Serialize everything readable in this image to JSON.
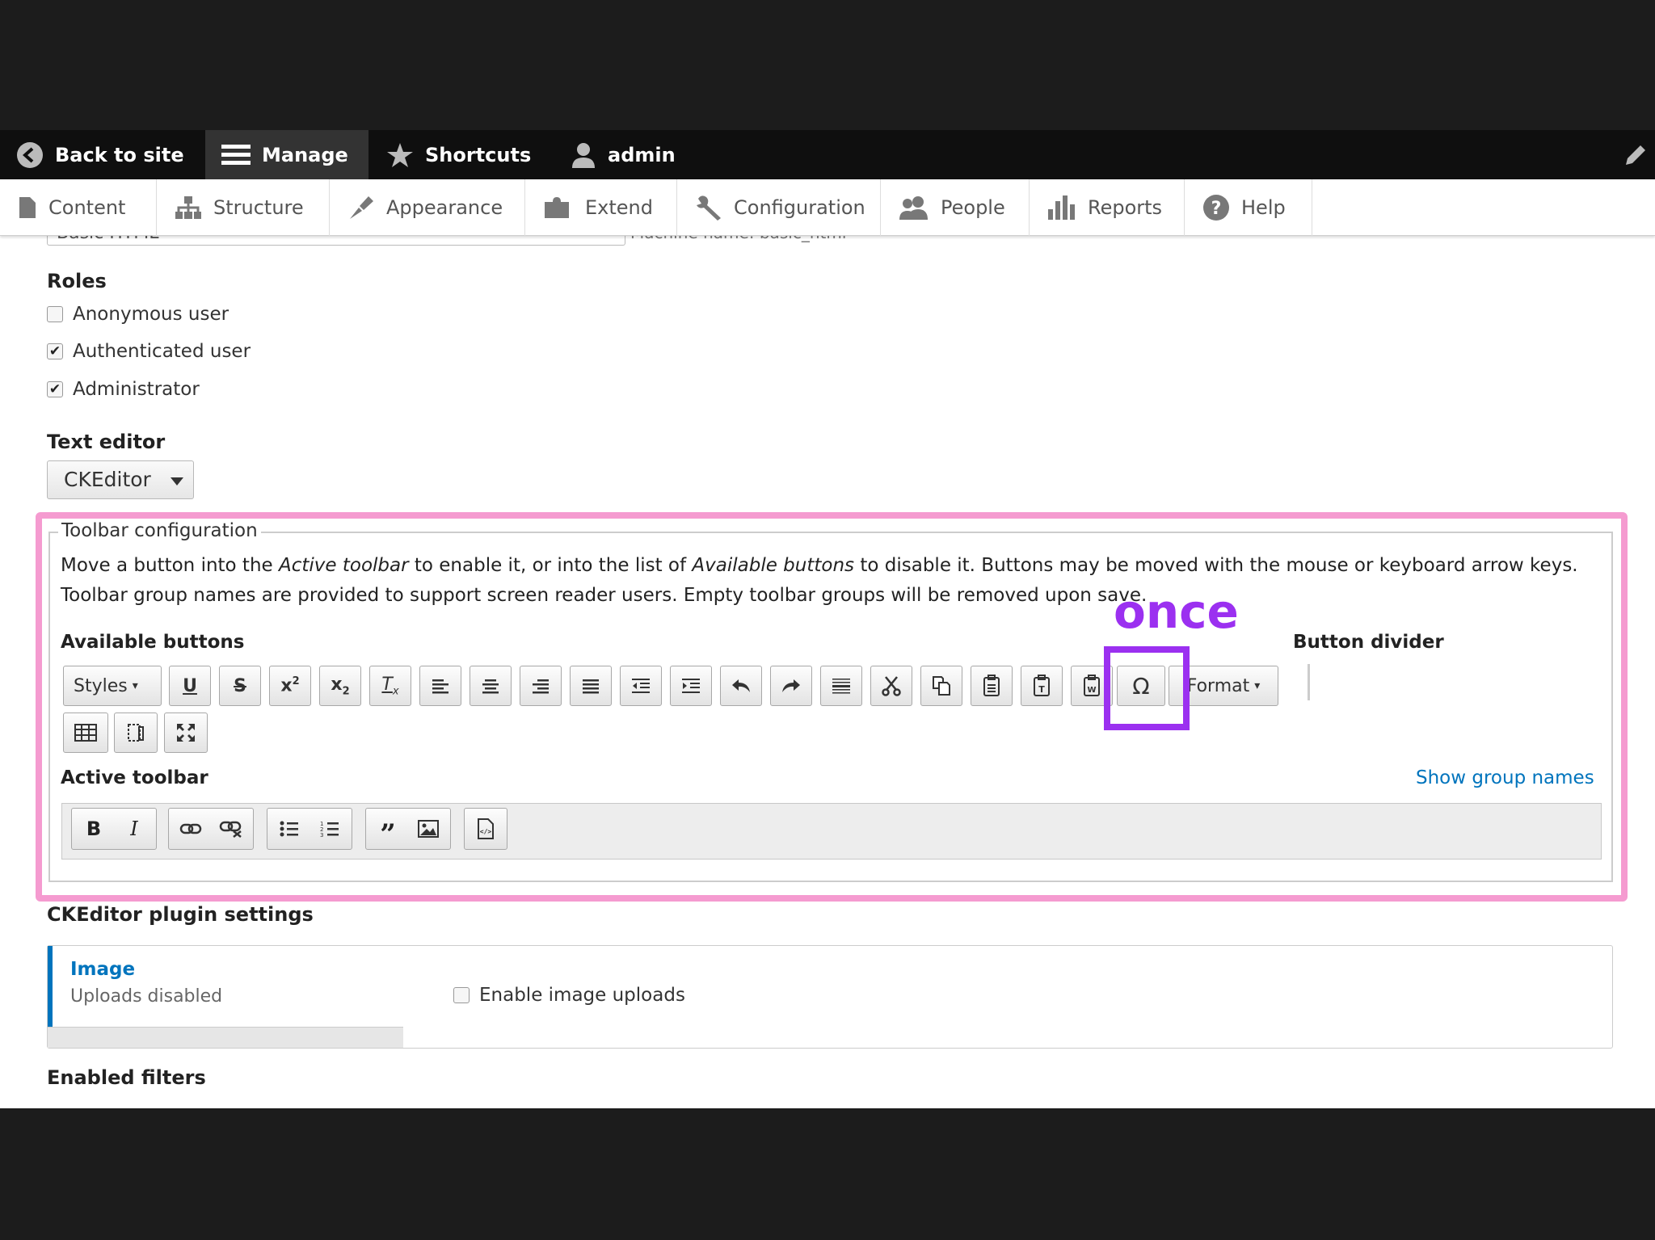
{
  "admin_bar": {
    "back": "Back to site",
    "manage": "Manage",
    "shortcuts": "Shortcuts",
    "user": "admin"
  },
  "tray": [
    "Content",
    "Structure",
    "Appearance",
    "Extend",
    "Configuration",
    "People",
    "Reports",
    "Help"
  ],
  "form": {
    "scrolled_name": "Basic HTML",
    "scrolled_machine": "Machine name: basic_html",
    "roles_label": "Roles",
    "roles": [
      {
        "label": "Anonymous user",
        "checked": false
      },
      {
        "label": "Authenticated user",
        "checked": true
      },
      {
        "label": "Administrator",
        "checked": true
      }
    ],
    "text_editor_label": "Text editor",
    "text_editor_value": "CKEditor"
  },
  "toolbar_config": {
    "legend": "Toolbar configuration",
    "desc_1": "Move a button into the ",
    "desc_em1": "Active toolbar",
    "desc_2": " to enable it, or into the list of ",
    "desc_em2": "Available buttons",
    "desc_3": " to disable it. Buttons may be moved with the mouse or keyboard arrow keys. Toolbar group names are provided to support screen reader users. Empty toolbar groups will be removed upon save.",
    "available_label": "Available buttons",
    "divider_label": "Button divider",
    "styles_label": "Styles",
    "format_label": "Format",
    "active_label": "Active toolbar",
    "show_group_names": "Show group names"
  },
  "annotation": {
    "label": "once",
    "color": "#9b30f0",
    "highlight_color": "#f59bd0"
  },
  "plugin": {
    "heading": "CKEditor plugin settings",
    "tab_title": "Image",
    "tab_summary": "Uploads disabled",
    "checkbox_label": "Enable image uploads"
  },
  "enabled_filters": "Enabled filters",
  "colors": {
    "link": "#0074bd",
    "admin_bar": "#0f0f0f"
  }
}
